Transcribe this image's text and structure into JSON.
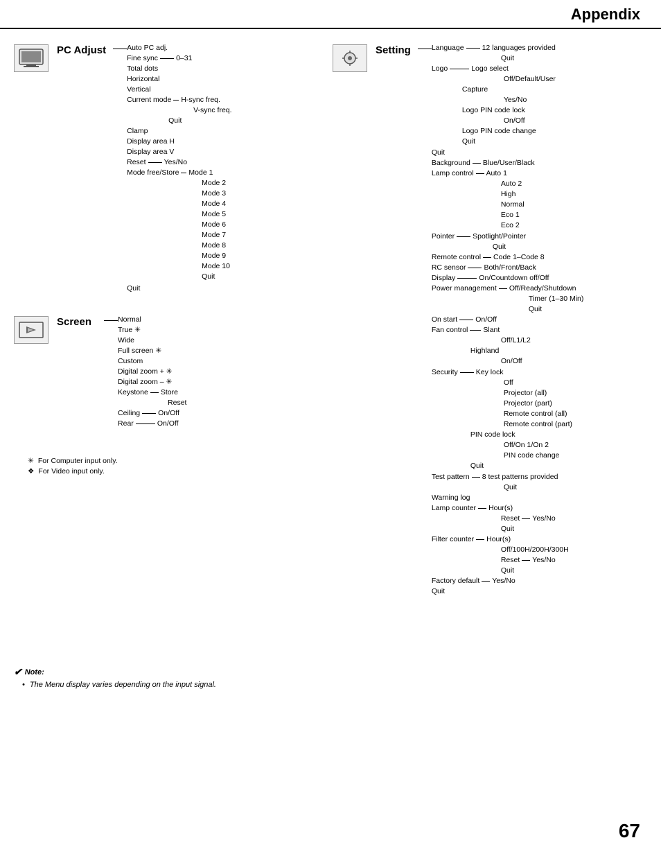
{
  "header": {
    "title": "Appendix"
  },
  "page_number": "67",
  "sections": {
    "pc_adjust": {
      "label": "PC Adjust",
      "items": [
        "Auto PC adj.",
        "Fine sync — 0–31",
        "Total dots",
        "Horizontal",
        "Vertical",
        "Current mode — H-sync freq.",
        "V-sync freq.",
        "Quit",
        "Clamp",
        "Display area H",
        "Display area V",
        "Reset — Yes/No",
        "Mode free/Store — Mode 1",
        "Mode 2",
        "Mode 3",
        "Mode 4",
        "Mode 5",
        "Mode 6",
        "Mode 7",
        "Mode 8",
        "Mode 9",
        "Mode 10",
        "Quit",
        "Quit"
      ]
    },
    "screen": {
      "label": "Screen",
      "items": [
        "Normal",
        "True ✳",
        "Wide",
        "Full screen ✳",
        "Custom",
        "Digital zoom + ✳",
        "Digital zoom – ✳",
        "Keystone — Store",
        "Reset",
        "Ceiling — On/Off",
        "Rear — On/Off"
      ]
    },
    "setting": {
      "label": "Setting",
      "items": [
        "Language — 12 languages provided",
        "Quit",
        "Logo — Logo select",
        "Off/Default/User",
        "Capture",
        "Yes/No",
        "Logo PIN code lock",
        "On/Off",
        "Logo PIN code change",
        "Quit",
        "Quit",
        "Background — Blue/User/Black",
        "Lamp control — Auto 1",
        "Auto 2",
        "High",
        "Normal",
        "Eco 1",
        "Eco 2",
        "Pointer — Spotlight/Pointer",
        "Quit",
        "Remote control — Code 1–Code 8",
        "RC sensor — Both/Front/Back",
        "Display — On/Countdown off/Off",
        "Power management — Off/Ready/Shutdown",
        "Timer (1–30 Min)",
        "Quit",
        "On start — On/Off",
        "Fan control — Slant",
        "Off/L1/L2",
        "Highland",
        "On/Off",
        "Security — Key lock",
        "Off",
        "Projector (all)",
        "Projector (part)",
        "Remote control (all)",
        "Remote control (part)",
        "PIN code lock",
        "Off/On 1/On 2",
        "PIN code change",
        "Quit",
        "Test pattern — 8 test patterns provided",
        "Quit",
        "Warning log",
        "Lamp counter — Hour(s)",
        "Reset — Yes/No",
        "Quit",
        "Filter counter — Hour(s)",
        "Off/100H/200H/300H",
        "Reset — Yes/No",
        "Quit",
        "Factory default — Yes/No",
        "Quit"
      ]
    }
  },
  "footnotes": {
    "star": "For Computer input only.",
    "diamond": "For Video input only."
  },
  "note": {
    "label": "Note:",
    "text": "The Menu display varies depending on the input signal."
  }
}
